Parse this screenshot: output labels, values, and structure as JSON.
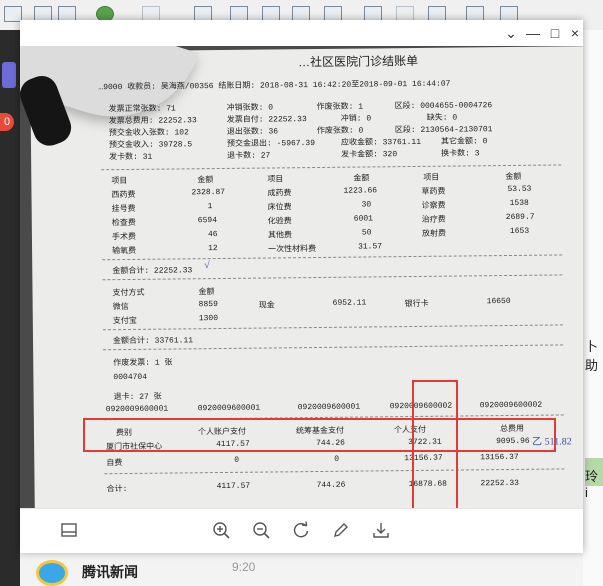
{
  "viewer": {
    "close_glyph": "×",
    "max_glyph": "□",
    "min_glyph": "—",
    "pin_glyph": "⌄"
  },
  "background": {
    "left_badge": "0",
    "right_text_1": "卜助",
    "right_text_2": "玲 i",
    "news_label": "腾讯新闻",
    "news_time": "9:20"
  },
  "receipt": {
    "title": "…社区医院门诊结账单",
    "header_line": "…9000      收款员: 吴海燕/00356  结账日期: 2018-08-31 16:42:20至2018-09-01 16:44:07",
    "stats": [
      [
        "发票正常张数: 71",
        "冲销张数: 0",
        "作废张数: 1",
        "区段: 0004655-0004726"
      ],
      [
        "发票总费用: 22252.33",
        "发票自付: 22252.33",
        "冲销: 0",
        "缺失: 0"
      ],
      [
        "预交金收入张数: 102",
        "退出张数: 36",
        "作废张数: 0",
        "区段: 2130564-2130701"
      ],
      [
        "预交金收入: 39728.5",
        "预交金退出: -5967.39",
        "应收金额: 33761.11",
        "其它金额: 0"
      ],
      [
        "发卡数: 31",
        "退卡数: 27",
        "发卡金额: 320",
        "换卡数: 3"
      ]
    ],
    "items_headers": [
      "项目",
      "金额",
      "项目",
      "金额",
      "项目",
      "金额"
    ],
    "items": [
      [
        "西药费",
        "2328.87",
        "成药费",
        "1223.66",
        "草药费",
        "53.53"
      ],
      [
        "挂号费",
        "1",
        "床位费",
        "30",
        "诊察费",
        "1538"
      ],
      [
        "检查费",
        "6594",
        "化验费",
        "6001",
        "治疗费",
        "2689.7"
      ],
      [
        "手术费",
        "46",
        "其他费",
        "50",
        "放射费",
        "1653"
      ],
      [
        "输氧费",
        "12",
        "一次性材料费",
        "31.57",
        "",
        ""
      ]
    ],
    "amount_total": "金额合计:  22252.33",
    "pay_headers": [
      "支付方式",
      "金额"
    ],
    "pay_rows": [
      [
        "微信",
        "8859",
        "现金",
        "6952.11",
        "银行卡",
        "16650"
      ],
      [
        "支付宝",
        "1300",
        "",
        "",
        "",
        ""
      ]
    ],
    "pay_total": "金额合计:  33761.11",
    "void_label": "作废发票: 1  张",
    "void_no": "0004704",
    "refund_label": "退卡: 27  张",
    "card_nos": [
      "0920009600001",
      "0920009600001",
      "0920009600001",
      "0920009600002",
      "0920009600002"
    ],
    "fund_headers": [
      "费别",
      "个人账户支付",
      "统筹基金支付",
      "个人支付",
      "总费用"
    ],
    "fund_rows": [
      [
        "厦门市社保中心",
        "4117.57",
        "744.26",
        "3722.31",
        "9095.96"
      ],
      [
        "自费",
        "0",
        "0",
        "13156.37",
        "13156.37"
      ]
    ],
    "fund_total": [
      "合计:",
      "4117.57",
      "744.26",
      "16878.68",
      "22252.33"
    ],
    "handwriting": "乙 511.82"
  },
  "icons": [
    "layout-icon",
    "zoom-in-icon",
    "zoom-out-icon",
    "rotate-icon",
    "edit-icon",
    "download-icon"
  ]
}
